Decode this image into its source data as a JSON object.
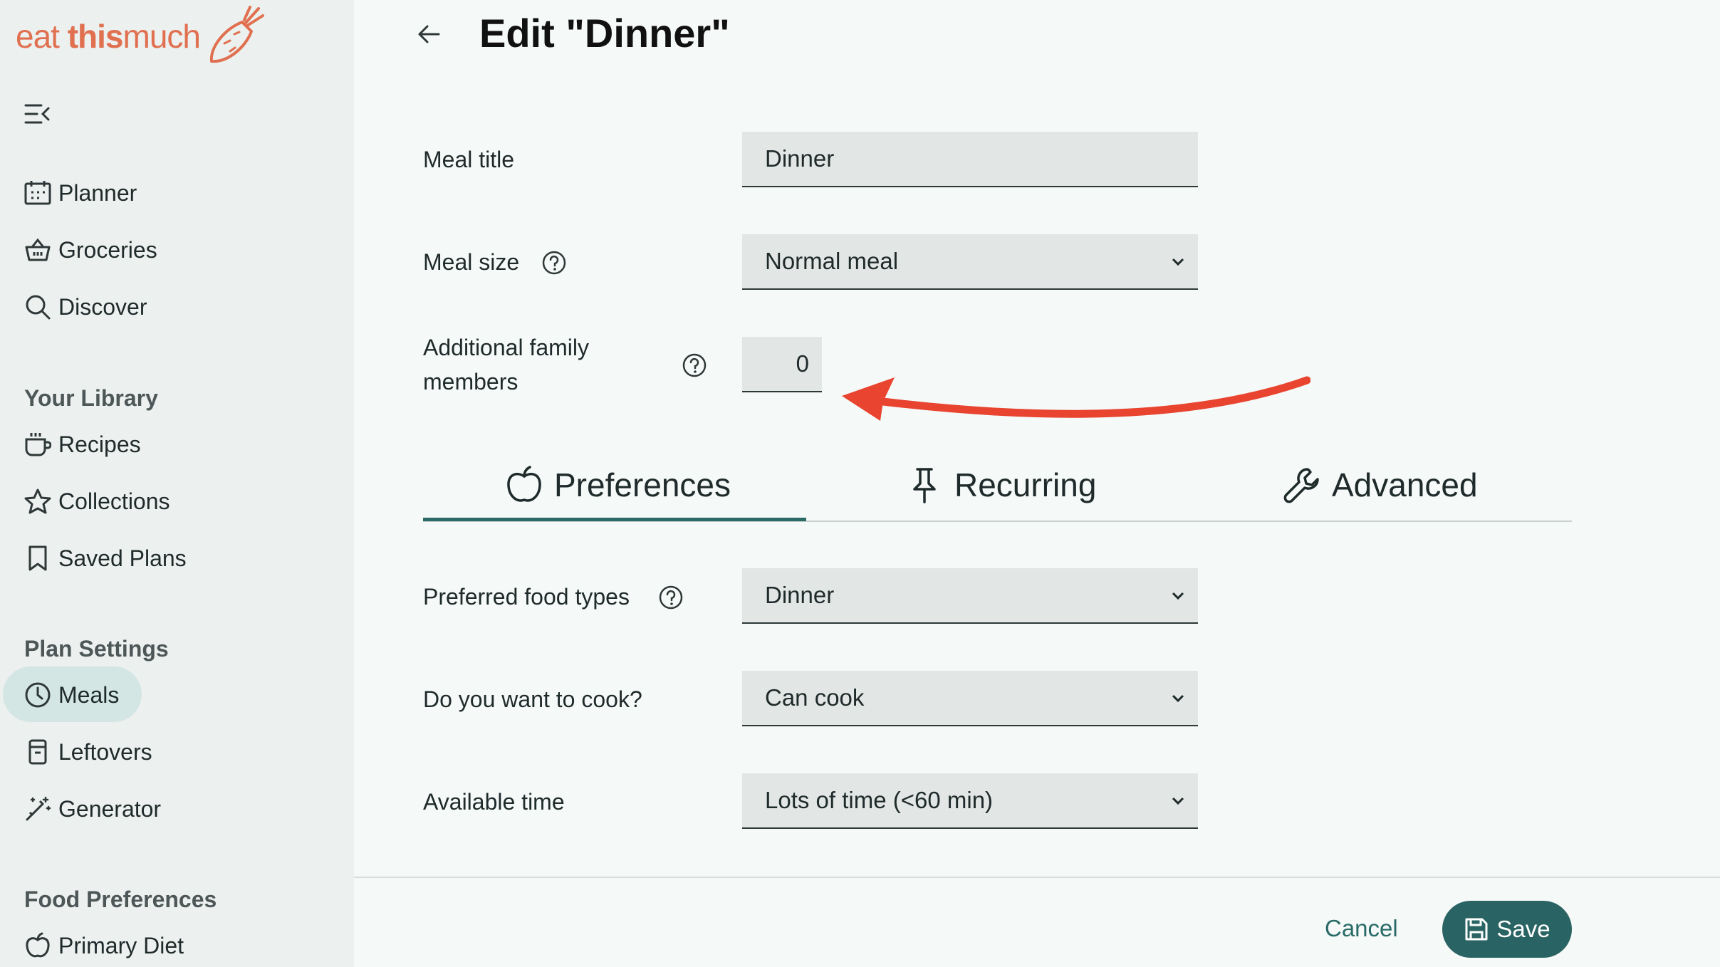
{
  "app": {
    "logo_text_1": "eat ",
    "logo_text_2": "this",
    "logo_text_3": "much"
  },
  "sidebar": {
    "toggle_icon": "collapse-menu-icon",
    "items": [
      {
        "label": "Planner",
        "icon": "calendar-icon"
      },
      {
        "label": "Groceries",
        "icon": "basket-icon"
      },
      {
        "label": "Discover",
        "icon": "search-icon"
      }
    ],
    "library_heading": "Your Library",
    "library_items": [
      {
        "label": "Recipes",
        "icon": "cup-icon"
      },
      {
        "label": "Collections",
        "icon": "star-icon"
      },
      {
        "label": "Saved Plans",
        "icon": "bookmark-icon"
      }
    ],
    "plan_heading": "Plan Settings",
    "plan_items": [
      {
        "label": "Meals",
        "icon": "clock-icon",
        "active": true
      },
      {
        "label": "Leftovers",
        "icon": "container-icon"
      },
      {
        "label": "Generator",
        "icon": "magic-wand-icon"
      }
    ],
    "food_heading": "Food Preferences",
    "food_items": [
      {
        "label": "Primary Diet",
        "icon": "apple-icon"
      }
    ]
  },
  "header": {
    "title": "Edit \"Dinner\""
  },
  "form": {
    "meal_title_label": "Meal title",
    "meal_title_value": "Dinner",
    "meal_size_label": "Meal size",
    "meal_size_value": "Normal meal",
    "family_label_1": "Additional family",
    "family_label_2": "members",
    "family_value": "0"
  },
  "tabs": [
    {
      "label": "Preferences",
      "icon": "apple-icon",
      "active": true
    },
    {
      "label": "Recurring",
      "icon": "pin-icon"
    },
    {
      "label": "Advanced",
      "icon": "wrench-icon"
    }
  ],
  "preferences": {
    "food_types_label": "Preferred food types",
    "food_types_value": "Dinner",
    "cook_label": "Do you want to cook?",
    "cook_value": "Can cook",
    "time_label": "Available time",
    "time_value": "Lots of time (<60 min)"
  },
  "footer": {
    "cancel_label": "Cancel",
    "save_label": "Save"
  },
  "colors": {
    "accent": "#2a6363",
    "brand": "#e07050",
    "arrow": "#e8442f"
  }
}
